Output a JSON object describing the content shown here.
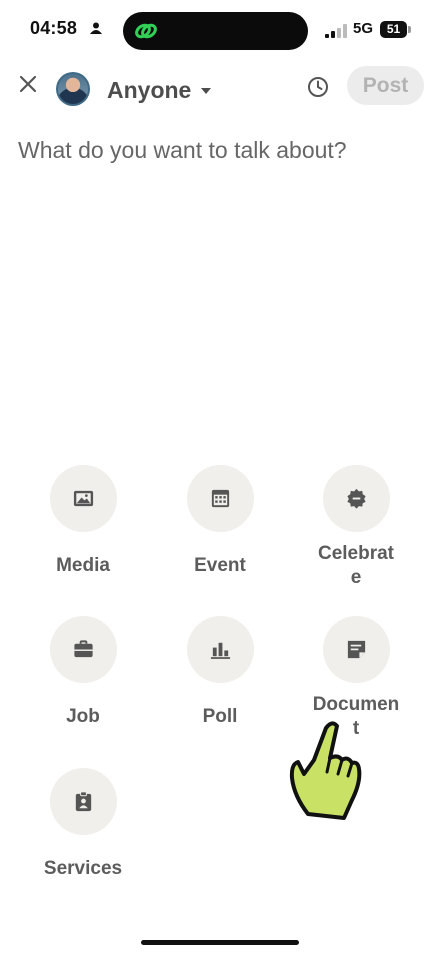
{
  "status_bar": {
    "time": "04:58",
    "network": "5G",
    "battery": "51",
    "icons": [
      "person-icon",
      "link-icon",
      "signal-icon"
    ]
  },
  "header": {
    "audience": "Anyone",
    "post_label": "Post",
    "icons": [
      "close-icon",
      "avatar",
      "chevron-down-icon",
      "clock-icon"
    ]
  },
  "composer": {
    "placeholder": "What do you want to talk about?",
    "value": ""
  },
  "actions": [
    {
      "label": "Media",
      "icon": "image-icon"
    },
    {
      "label": "Event",
      "icon": "calendar-icon"
    },
    {
      "label": "Celebrat\ne",
      "icon": "badge-icon"
    },
    {
      "label": "Job",
      "icon": "briefcase-icon"
    },
    {
      "label": "Poll",
      "icon": "bar-chart-icon"
    },
    {
      "label": "Documen\nt",
      "icon": "document-icon"
    },
    {
      "label": "Services",
      "icon": "id-badge-icon"
    }
  ],
  "overlay": {
    "icon": "pointing-hand-icon",
    "color": "#c9e265"
  },
  "colors": {
    "icon_gray": "#555555",
    "circle_bg": "#f1efeb",
    "post_bg": "#ececec"
  }
}
